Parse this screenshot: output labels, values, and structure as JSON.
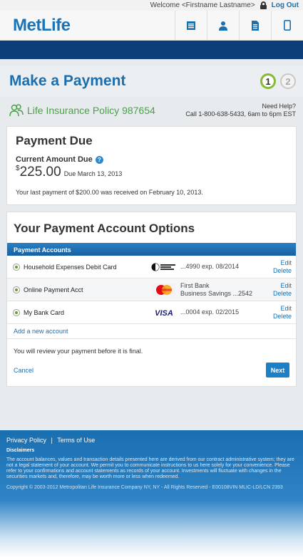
{
  "topbar": {
    "welcome": "Welcome <Firstname Lastname>",
    "logout": "Log Out"
  },
  "header": {
    "logo": "MetLife",
    "icons": [
      "list-icon",
      "user-icon",
      "document-icon",
      "mobile-icon"
    ]
  },
  "title": {
    "text": "Make a Payment",
    "step1": "1",
    "step2": "2"
  },
  "policy": {
    "name": "Life Insurance Policy 987654",
    "help_title": "Need Help?",
    "help_phone": "Call 1-800-638-5433, 6am to 6pm EST"
  },
  "payment_due": {
    "heading": "Payment Due",
    "label": "Current Amount Due",
    "currency": "$",
    "amount": "225.00",
    "due_date": "Due March 13, 2013",
    "last_payment": "Your last payment of $200.00 was received on February 10, 2013."
  },
  "options": {
    "heading": "Your Payment Account Options",
    "table_header": "Payment Accounts",
    "accounts": [
      {
        "name": "Household Expenses Debit Card",
        "info1": "...4990  exp. 08/2014",
        "info2": "",
        "logo": "direct-debit-logo"
      },
      {
        "name": "Online Payment Acct",
        "info1": "First Bank",
        "info2": "Business Savings ...2542",
        "logo": "mastercard-logo"
      },
      {
        "name": "My Bank Card",
        "info1": "...0004  exp. 02/2015",
        "info2": "",
        "logo": "visa-logo"
      }
    ],
    "edit": "Edit",
    "delete": "Delete",
    "add_account": "Add a new account",
    "review_note": "You will review your payment before it is final.",
    "cancel": "Cancel",
    "next": "Next"
  },
  "footer": {
    "privacy": "Privacy Policy",
    "separator": "|",
    "terms": "Terms of Use",
    "disclaimers_title": "Disclaimers",
    "disclaimer": "The account balances, values and transaction details presented here are derived from our contract administrative system; they are not a legal statement of your account. We permit you to communicate instructions to us here solely for your convenience. Please refer to your confirmations and account statements as records of your account. Investments will fluctuate with changes in the securities markets and, therefore, may be worth more or less when redeemed.",
    "copyright": "Copyright © 2003-2012 Metropolitan Life Insurance Company NY, NY - All Rights Reserved - E00108VIN MLIC-LD/LCN 2393"
  },
  "colors": {
    "brand_blue": "#1a6fb0",
    "nav_dark": "#0d3e7a",
    "policy_green": "#4aa04a",
    "step_green": "#8ab936"
  }
}
